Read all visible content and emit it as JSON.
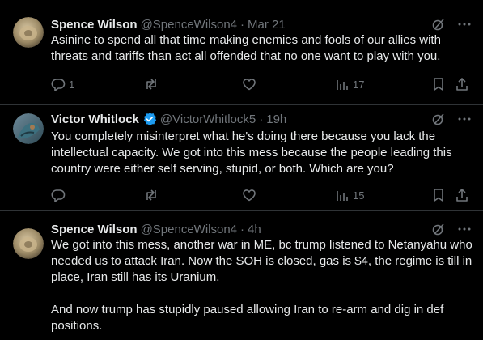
{
  "tweets": [
    {
      "author": "Spence Wilson",
      "handle": "@SpenceWilson4",
      "dot": "·",
      "time": "Mar 21",
      "verified": false,
      "text": "Asinine to spend all that time making enemies and fools of our allies with threats and tariffs than act all offended that no one want to play with you.",
      "replies": "1",
      "retweets": "",
      "likes": "",
      "views": "17"
    },
    {
      "author": "Victor Whitlock",
      "handle": "@VictorWhitlock5",
      "dot": "·",
      "time": "19h",
      "verified": true,
      "text": "You completely misinterpret what he's doing there because you lack the intellectual capacity. We got into this mess because the people leading this country were either self serving, stupid, or both. Which are you?",
      "replies": "",
      "retweets": "",
      "likes": "",
      "views": "15"
    },
    {
      "author": "Spence Wilson",
      "handle": "@SpenceWilson4",
      "dot": "·",
      "time": "4h",
      "verified": false,
      "text": "We got into this mess, another war in ME, bc trump listened to Netanyahu who needed us to attack Iran. Now the SOH is closed, gas is $4, the regime is till in place, Iran still has its Uranium.\n\nAnd now trump has stupidly paused allowing Iran to re-arm and dig in def positions."
    }
  ],
  "colors": {
    "background": "#000000",
    "text": "#e7e9ea",
    "muted": "#71767b",
    "divider": "#2f3336",
    "verified": "#1d9bf0"
  },
  "icons": [
    "grok-icon",
    "more-icon",
    "reply-icon",
    "retweet-icon",
    "like-icon",
    "views-icon",
    "bookmark-icon",
    "share-icon",
    "verified-badge-icon"
  ]
}
